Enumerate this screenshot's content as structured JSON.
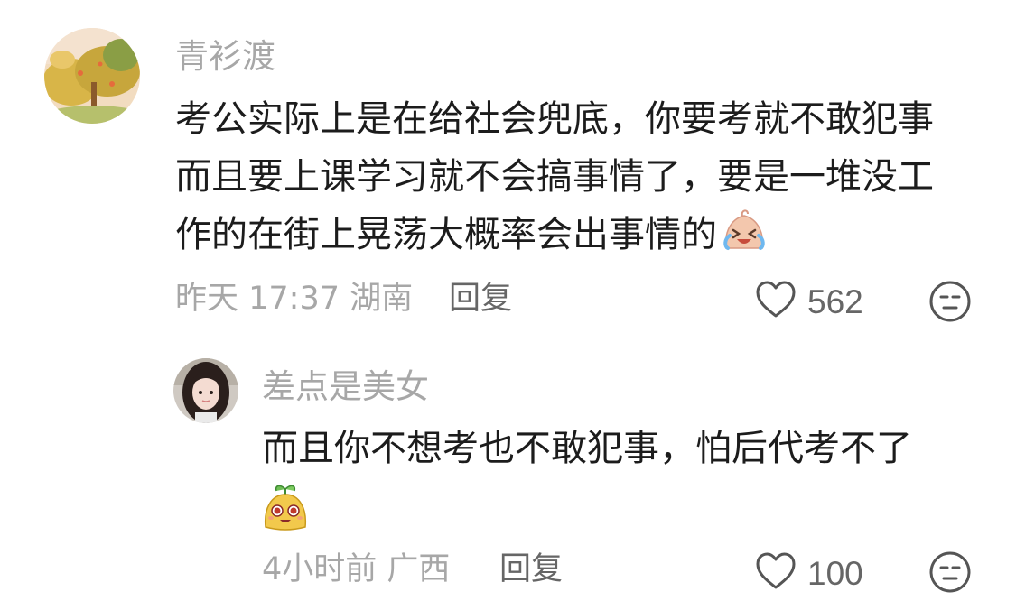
{
  "comments": [
    {
      "username": "青衫渡",
      "lines": [
        "考公实际上是在给社会兜底，你要考就不敢犯事",
        "而且要上课学习就不会搞事情了，要是一堆没工",
        "作的在街上晃荡大概率会出事情的"
      ],
      "trailing_emoji": "crying-laughing-emoji",
      "time_location": "昨天 17:37 湖南",
      "reply_label": "回复",
      "like_count": "562"
    },
    {
      "username": "差点是美女",
      "lines": [
        "而且你不想考也不敢犯事，怕后代考不了"
      ],
      "sticker": "sprout-mascot-sticker",
      "time_location": "4小时前 广西",
      "reply_label": "回复",
      "like_count": "100"
    }
  ]
}
